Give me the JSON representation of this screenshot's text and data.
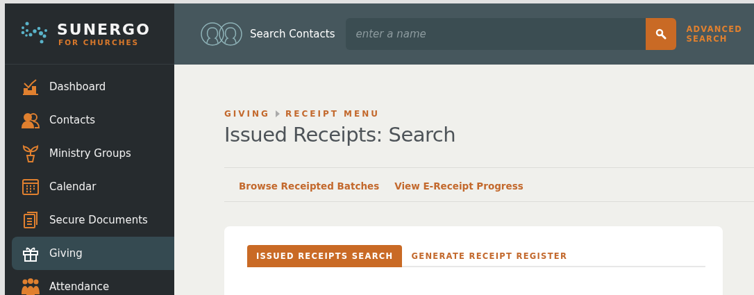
{
  "brand": {
    "name": "SUNERGO",
    "tagline": "FOR CHURCHES"
  },
  "sidebar": {
    "items": [
      {
        "label": "Dashboard",
        "selected": false
      },
      {
        "label": "Contacts",
        "selected": false
      },
      {
        "label": "Ministry Groups",
        "selected": false
      },
      {
        "label": "Calendar",
        "selected": false
      },
      {
        "label": "Secure Documents",
        "selected": false
      },
      {
        "label": "Giving",
        "selected": true
      },
      {
        "label": "Attendance",
        "selected": false
      }
    ]
  },
  "header": {
    "search_label": "Search Contacts",
    "search": {
      "placeholder": "enter a name"
    },
    "advanced_search": "ADVANCED SEARCH"
  },
  "breadcrumb": [
    "GIVING",
    "RECEIPT MENU"
  ],
  "title": "Issued Receipts: Search",
  "links": [
    "Browse Receipted Batches",
    "View E-Receipt Progress"
  ],
  "tabs": [
    {
      "label": "ISSUED RECEIPTS SEARCH",
      "selected": true
    },
    {
      "label": "GENERATE RECEIPT REGISTER",
      "selected": false
    }
  ]
}
